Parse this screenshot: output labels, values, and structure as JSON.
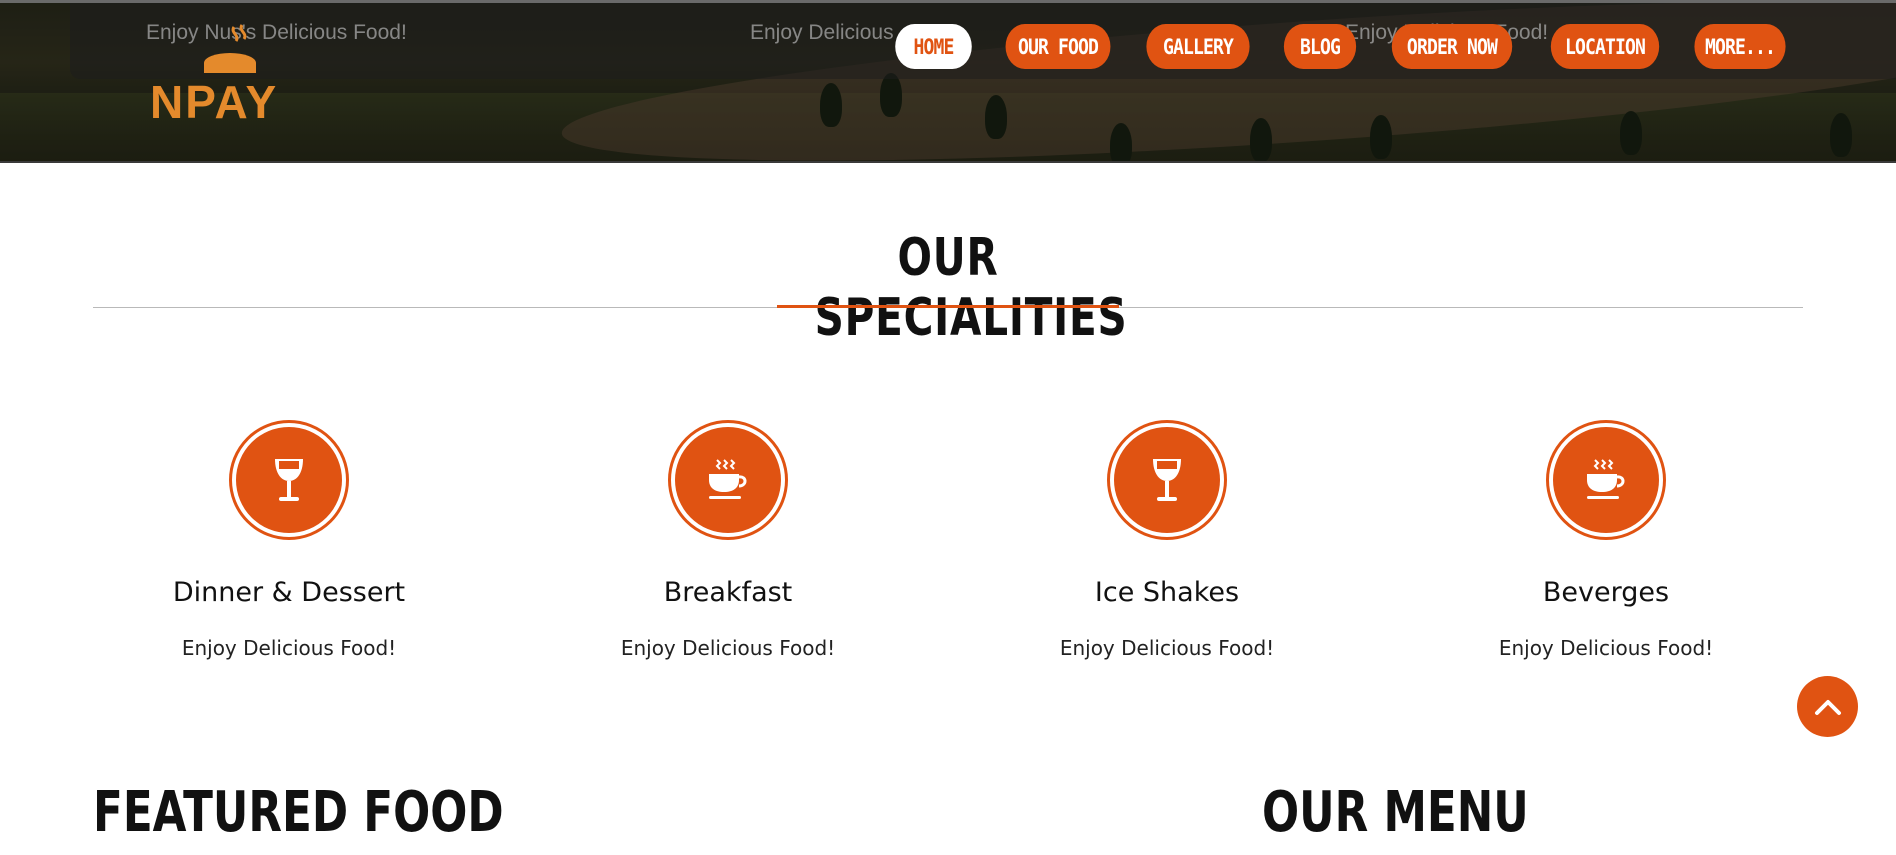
{
  "hero": {
    "ghost_text_1": "Enjoy Nus's Delicious Food!",
    "ghost_text_2": "Enjoy Delicious",
    "ghost_text_3": "Enjoy Delicious Food!",
    "logo_text": "NPAY"
  },
  "nav": {
    "items": [
      {
        "label": "HOME",
        "active": true
      },
      {
        "label": "OUR FOOD",
        "active": false
      },
      {
        "label": "GALLERY",
        "active": false
      },
      {
        "label": "BLOG",
        "active": false
      },
      {
        "label": "ORDER NOW",
        "active": false
      },
      {
        "label": "LOCATION",
        "active": false
      },
      {
        "label": "MORE...",
        "active": false
      }
    ]
  },
  "specialities": {
    "title": "OUR SPECIALITIES",
    "items": [
      {
        "icon": "wine-glass-icon",
        "title": "Dinner & Dessert",
        "text": "Enjoy Delicious Food!"
      },
      {
        "icon": "coffee-cup-icon",
        "title": "Breakfast",
        "text": "Enjoy Delicious Food!"
      },
      {
        "icon": "wine-glass-icon",
        "title": "Ice Shakes",
        "text": "Enjoy Delicious Food!"
      },
      {
        "icon": "coffee-cup-icon",
        "title": "Beverges",
        "text": "Enjoy Delicious Food!"
      }
    ]
  },
  "featured": {
    "title": "FEATURED FOOD"
  },
  "menu": {
    "title": "OUR MENU"
  },
  "colors": {
    "accent": "#e05312",
    "text": "#111111"
  }
}
